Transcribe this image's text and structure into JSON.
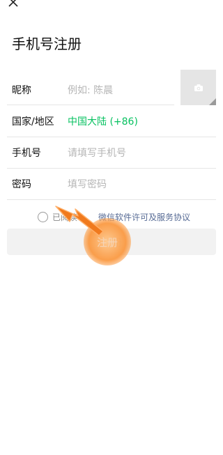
{
  "header": {
    "close_icon": "close-icon",
    "title": "手机号注册"
  },
  "form": {
    "nickname": {
      "label": "昵称",
      "placeholder": "例如: 陈晨"
    },
    "country": {
      "label": "国家/地区",
      "value": "中国大陆 (+86)"
    },
    "phone": {
      "label": "手机号",
      "placeholder": "请填写手机号"
    },
    "password": {
      "label": "密码",
      "placeholder": "填写密码"
    },
    "avatar_icon": "camera-icon"
  },
  "agreement": {
    "prefix": "已阅读",
    "link": "微信软件许可及服务协议"
  },
  "register_button": {
    "label": "注册"
  },
  "colors": {
    "green": "#07c160",
    "link": "#576b95",
    "arrow": "#f07a1e"
  }
}
